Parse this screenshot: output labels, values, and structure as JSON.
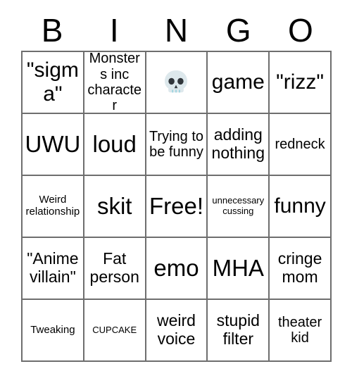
{
  "card": {
    "header_letters": [
      "B",
      "I",
      "N",
      "G",
      "O"
    ],
    "rows": [
      [
        {
          "text": "\"sigma\"",
          "size": "fs-lg",
          "type": "text"
        },
        {
          "text": "Monsters inc character",
          "size": "fs-sm",
          "type": "text"
        },
        {
          "text": "skull-emoji",
          "size": "fs-lg",
          "type": "emoji"
        },
        {
          "text": "game",
          "size": "fs-lg",
          "type": "text"
        },
        {
          "text": "\"rizz\"",
          "size": "fs-lg",
          "type": "text"
        }
      ],
      [
        {
          "text": "UWU",
          "size": "fs-xl",
          "type": "text"
        },
        {
          "text": "loud",
          "size": "fs-xl",
          "type": "text"
        },
        {
          "text": "Trying to be funny",
          "size": "fs-sm",
          "type": "text"
        },
        {
          "text": "adding nothing",
          "size": "fs-md",
          "type": "text"
        },
        {
          "text": "redneck",
          "size": "fs-sm",
          "type": "text"
        }
      ],
      [
        {
          "text": "Weird relationship",
          "size": "fs-xs",
          "type": "text"
        },
        {
          "text": "skit",
          "size": "fs-xl",
          "type": "text"
        },
        {
          "text": "Free!",
          "size": "fs-xl",
          "type": "text"
        },
        {
          "text": "unnecessary cussing",
          "size": "fs-xxs",
          "type": "text"
        },
        {
          "text": "funny",
          "size": "fs-lg",
          "type": "text"
        }
      ],
      [
        {
          "text": "\"Anime villain\"",
          "size": "fs-md",
          "type": "text"
        },
        {
          "text": "Fat person",
          "size": "fs-md",
          "type": "text"
        },
        {
          "text": "emo",
          "size": "fs-xl",
          "type": "text"
        },
        {
          "text": "MHA",
          "size": "fs-xl",
          "type": "text"
        },
        {
          "text": "cringe mom",
          "size": "fs-md",
          "type": "text"
        }
      ],
      [
        {
          "text": "Tweaking",
          "size": "fs-xs",
          "type": "text"
        },
        {
          "text": "CUPCAKE",
          "size": "fs-xxs",
          "type": "text"
        },
        {
          "text": "weird voice",
          "size": "fs-md",
          "type": "text"
        },
        {
          "text": "stupid filter",
          "size": "fs-md",
          "type": "text"
        },
        {
          "text": "theater kid",
          "size": "fs-sm",
          "type": "text"
        }
      ]
    ],
    "colors": {
      "border": "#6e6e6e",
      "text": "#000000",
      "background": "#ffffff",
      "skull_body": "#dde8ec",
      "skull_features": "#31363b",
      "skull_teeth": "#9fd4e0"
    }
  }
}
